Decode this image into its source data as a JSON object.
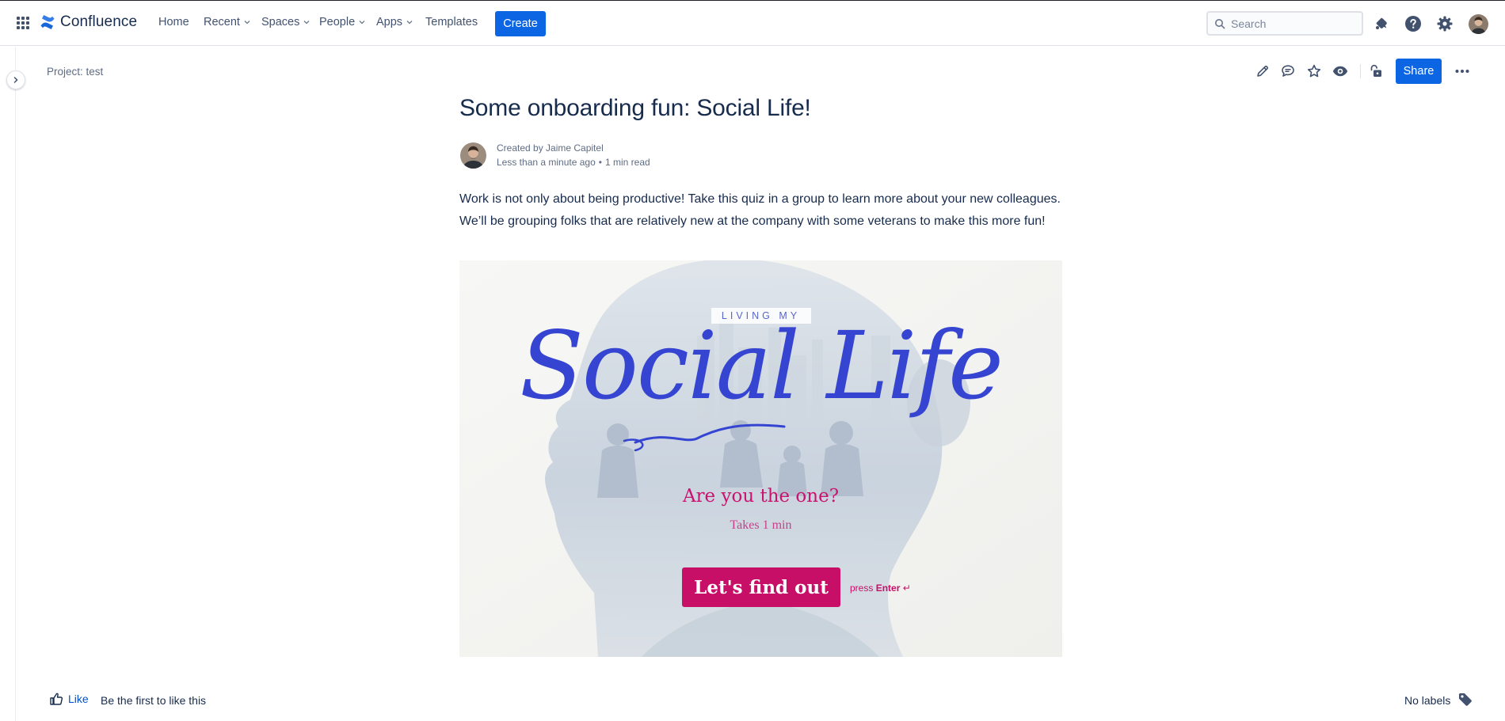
{
  "topnav": {
    "app_name": "Confluence",
    "items": [
      {
        "label": "Home",
        "has_menu": false
      },
      {
        "label": "Recent",
        "has_menu": true
      },
      {
        "label": "Spaces",
        "has_menu": true
      },
      {
        "label": "People",
        "has_menu": true
      },
      {
        "label": "Apps",
        "has_menu": true
      },
      {
        "label": "Templates",
        "has_menu": false
      }
    ],
    "create_label": "Create",
    "search_placeholder": "Search",
    "brand_color": "#0c66e4"
  },
  "page_header": {
    "breadcrumb": "Project: test",
    "share_label": "Share"
  },
  "page": {
    "title": "Some onboarding fun: Social Life!",
    "byline": {
      "created_by": "Created by Jaime Capitel",
      "updated": "Less than a minute ago",
      "separator": "•",
      "read_time": "1 min read"
    },
    "paragraphs": [
      "Work is not only about being productive! Take this quiz in a group to learn more about your new colleagues.",
      "We’ll be grouping folks that are relatively new at the company with some veterans to make this more fun!"
    ]
  },
  "embed": {
    "kicker": "LIVING MY",
    "script_title": "Social Life",
    "question": "Are you the one?",
    "duration": "Takes 1 min",
    "cta_label": "Let's find out",
    "hint_prefix": "press",
    "hint_key": "Enter",
    "hint_glyph": "↵",
    "accent_color": "#c70f68",
    "script_color": "#3545d1"
  },
  "footer": {
    "like_label": "Like",
    "like_note": "Be the first to like this",
    "labels_text": "No labels"
  }
}
